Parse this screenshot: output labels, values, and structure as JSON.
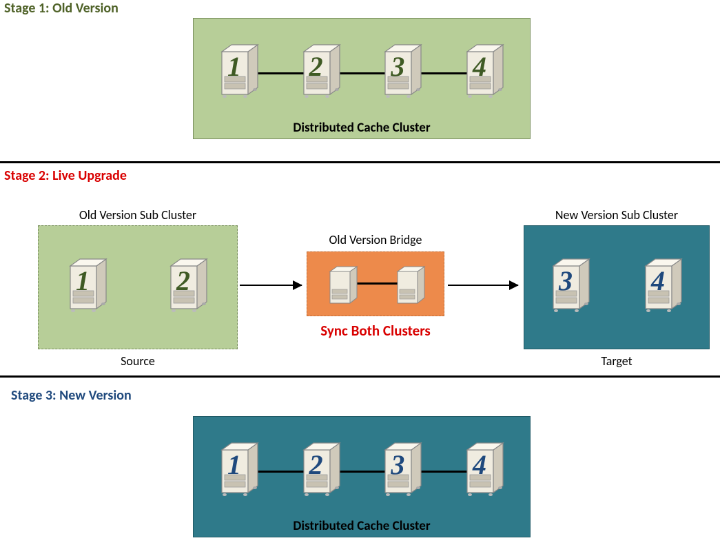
{
  "stage1": {
    "title_prefix": "Stage 1: ",
    "title_rest": "Old Version",
    "cluster_label": "Distributed Cache Cluster",
    "servers": [
      "1",
      "2",
      "3",
      "4"
    ]
  },
  "stage2": {
    "title_prefix": "Stage 2: ",
    "title_rest": "Live Upgrade",
    "old_sub_label": "Old Version Sub Cluster",
    "bridge_label": "Old Version Bridge",
    "new_sub_label": "New Version Sub Cluster",
    "sync_label": "Sync Both Clusters",
    "source_label": "Source",
    "target_label": "Target",
    "old_servers": [
      "1",
      "2"
    ],
    "bridge_servers": [
      "",
      ""
    ],
    "new_servers": [
      "3",
      "4"
    ]
  },
  "stage3": {
    "title_prefix": "Stage 3: ",
    "title_rest": "New Version",
    "cluster_label": "Distributed Cache Cluster",
    "servers": [
      "1",
      "2",
      "3",
      "4"
    ]
  },
  "colors": {
    "olive_title": "#4f6228",
    "red_title": "#d90000",
    "navy_title": "#1f497d",
    "green_bg": "#b7ce98",
    "teal_bg": "#2f7a8a",
    "orange_bg": "#ed8a4b"
  }
}
